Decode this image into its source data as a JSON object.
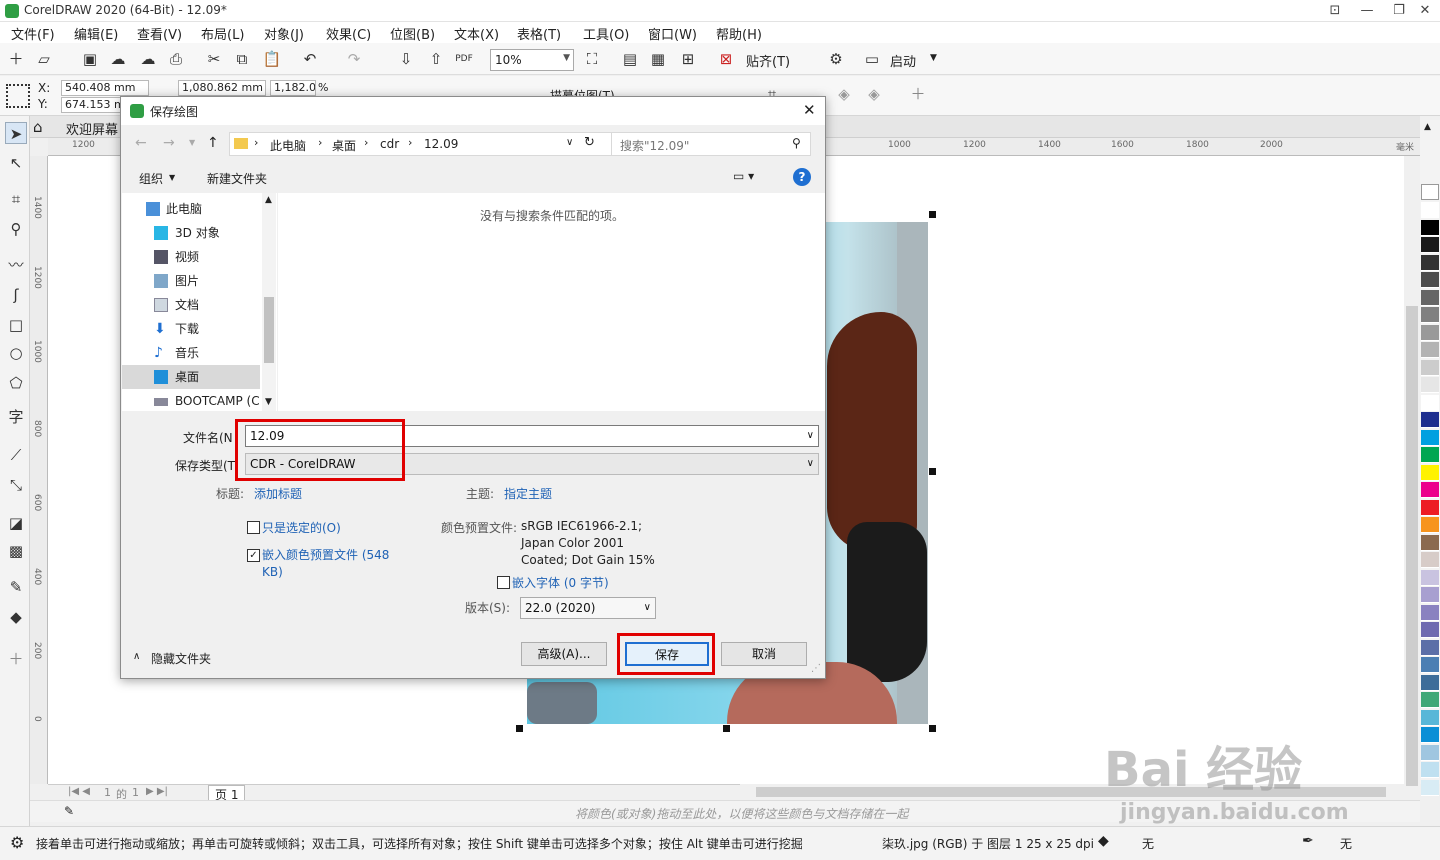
{
  "app": {
    "title": "CorelDRAW 2020 (64-Bit) - 12.09*"
  },
  "menu": [
    "文件(F)",
    "编辑(E)",
    "查看(V)",
    "布局(L)",
    "对象(J)",
    "效果(C)",
    "位图(B)",
    "文本(X)",
    "表格(T)",
    "工具(O)",
    "窗口(W)",
    "帮助(H)"
  ],
  "toolbar": {
    "zoom": "10%",
    "snap_label": "贴齐(T)",
    "launch_label": "启动"
  },
  "property_bar": {
    "x_label": "X:",
    "y_label": "Y:",
    "x_value": "540.408 mm",
    "y_value": "674.153 mm",
    "width_value": "1,080.862 mm",
    "scale_value": "1,182.0",
    "scale_unit": "%",
    "trace_label": "描摹位图(T)"
  },
  "tabs": {
    "welcome": "欢迎屏幕"
  },
  "rulers": {
    "h_ticks": [
      "1200",
      "1000",
      "1200",
      "1400",
      "1600",
      "1800",
      "2000",
      "毫米"
    ],
    "v_ticks": [
      "1400",
      "1200",
      "1000",
      "800",
      "600",
      "400",
      "200",
      "0"
    ]
  },
  "page_nav": {
    "current": "1",
    "of_label": "的",
    "total": "1",
    "page_tab": "页 1"
  },
  "hint_bar": "将颜色(或对象)拖动至此处，以便将这些颜色与文档存储在一起",
  "status_bar": {
    "message": "接着单击可进行拖动或缩放；再单击可旋转或倾斜；双击工具，可选择所有对象；按住 Shift 键单击可选择多个对象；按住 Alt 键单击可进行挖掘",
    "object_info": "柒玖.jpg (RGB) 于 图层 1 25 x 25 dpi",
    "fill_label": "无",
    "outline_label": "无"
  },
  "palette_colors": [
    "#ffffff",
    "#000000",
    "#1a1a1a",
    "#333333",
    "#4d4d4d",
    "#666666",
    "#808080",
    "#999999",
    "#b3b3b3",
    "#cccccc",
    "#e6e6e6",
    "#ffffff",
    "#1e2f8f",
    "#00a0e0",
    "#00a651",
    "#fff200",
    "#ec008c",
    "#ed1c24",
    "#f7941d",
    "#8b6a4f",
    "#d7ccc8",
    "#c9c3e0",
    "#a89fd0",
    "#8a82c0",
    "#6f6ab0",
    "#5b6fa8",
    "#4b7fb3",
    "#3e6d99",
    "#40a878",
    "#58b7d8",
    "#0a8fd6",
    "#9fc6e0",
    "#bfe0f0",
    "#d8ecf5"
  ],
  "watermark": {
    "text": "Bai 经验",
    "url": "jingyan.baidu.com"
  },
  "dialog": {
    "title": "保存绘图",
    "breadcrumb": [
      "此电脑",
      "桌面",
      "cdr",
      "12.09"
    ],
    "search_placeholder": "搜索\"12.09\"",
    "organize": "组织",
    "new_folder": "新建文件夹",
    "nav_items": [
      {
        "label": "此电脑",
        "icon": "computer-icon"
      },
      {
        "label": "3D 对象",
        "icon": "cube-icon"
      },
      {
        "label": "视频",
        "icon": "video-icon"
      },
      {
        "label": "图片",
        "icon": "picture-icon"
      },
      {
        "label": "文档",
        "icon": "document-icon"
      },
      {
        "label": "下载",
        "icon": "download-icon"
      },
      {
        "label": "音乐",
        "icon": "music-icon"
      },
      {
        "label": "桌面",
        "icon": "desktop-icon"
      },
      {
        "label": "BOOTCAMP (C",
        "icon": "drive-icon"
      }
    ],
    "empty_message": "没有与搜索条件匹配的项。",
    "filename_label": "文件名(N",
    "filename_value": "12.09",
    "filetype_label": "保存类型(T",
    "filetype_value": "CDR - CorelDRAW",
    "tags_label": "标题:",
    "tags_link": "添加标题",
    "subject_label": "主题:",
    "subject_link": "指定主题",
    "selected_only": "只是选定的(O)",
    "embed_color": "嵌入颜色预置文件 (548 KB)",
    "color_profile_label": "颜色预置文件:",
    "color_profile_value": [
      "sRGB IEC61966-2.1;",
      "Japan Color 2001",
      "Coated; Dot Gain 15%"
    ],
    "embed_fonts": "嵌入字体 (0 字节)",
    "version_label": "版本(S):",
    "version_value": "22.0 (2020)",
    "advanced_button": "高级(A)...",
    "save_button": "保存",
    "cancel_button": "取消",
    "hide_folders": "隐藏文件夹",
    "selected_only_checked": false,
    "embed_color_checked": true,
    "embed_fonts_checked": false
  }
}
